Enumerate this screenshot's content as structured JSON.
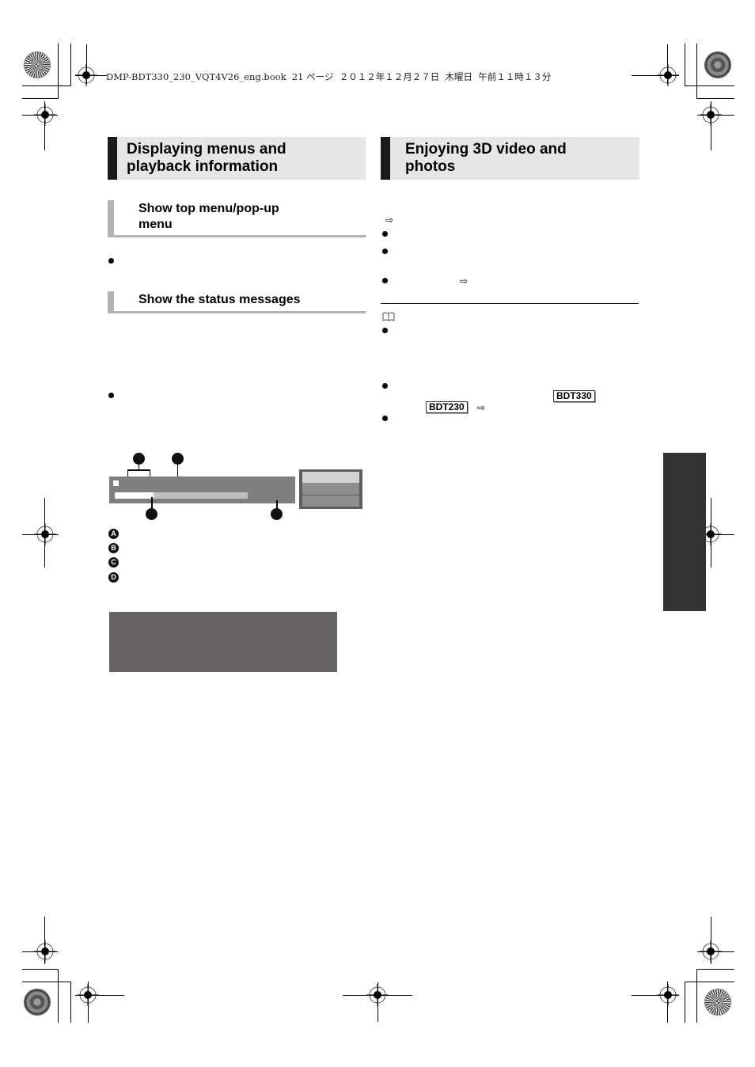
{
  "print_header": {
    "text": "DMP-BDT330_230_VQT4V26_eng.book  21 ページ  ２０１２年１２月２７日  木曜日  午前１１時１３分"
  },
  "left_column": {
    "section_title_line1": "Displaying menus and",
    "section_title_line2": "playback information",
    "subsections": [
      {
        "title_line1": "Show top menu/pop-up",
        "title_line2": "menu"
      },
      {
        "title_line1": "Show the status messages"
      }
    ],
    "osd_diagram": {
      "callouts": [
        "A",
        "B",
        "C",
        "D"
      ],
      "progress_fraction": 0.29,
      "menu_rows": 3,
      "highlighted_menu_row": 1
    },
    "legend": [
      "A",
      "B",
      "C",
      "D"
    ]
  },
  "right_column": {
    "section_title_line1": "Enjoying 3D video and",
    "section_title_line2": "photos",
    "arrow_symbol": "⇨",
    "note_icon": "book-icon",
    "badges": {
      "model_a": "BDT330",
      "model_b": "BDT230"
    }
  },
  "colors": {
    "heading_bg": "#e6e6e6",
    "heading_bar": "#1a1a1a",
    "subheading_rule": "#b3b3b3",
    "osd_bar": "#7f7f7f",
    "gray_box": "#656363",
    "side_tab": "#333333"
  }
}
